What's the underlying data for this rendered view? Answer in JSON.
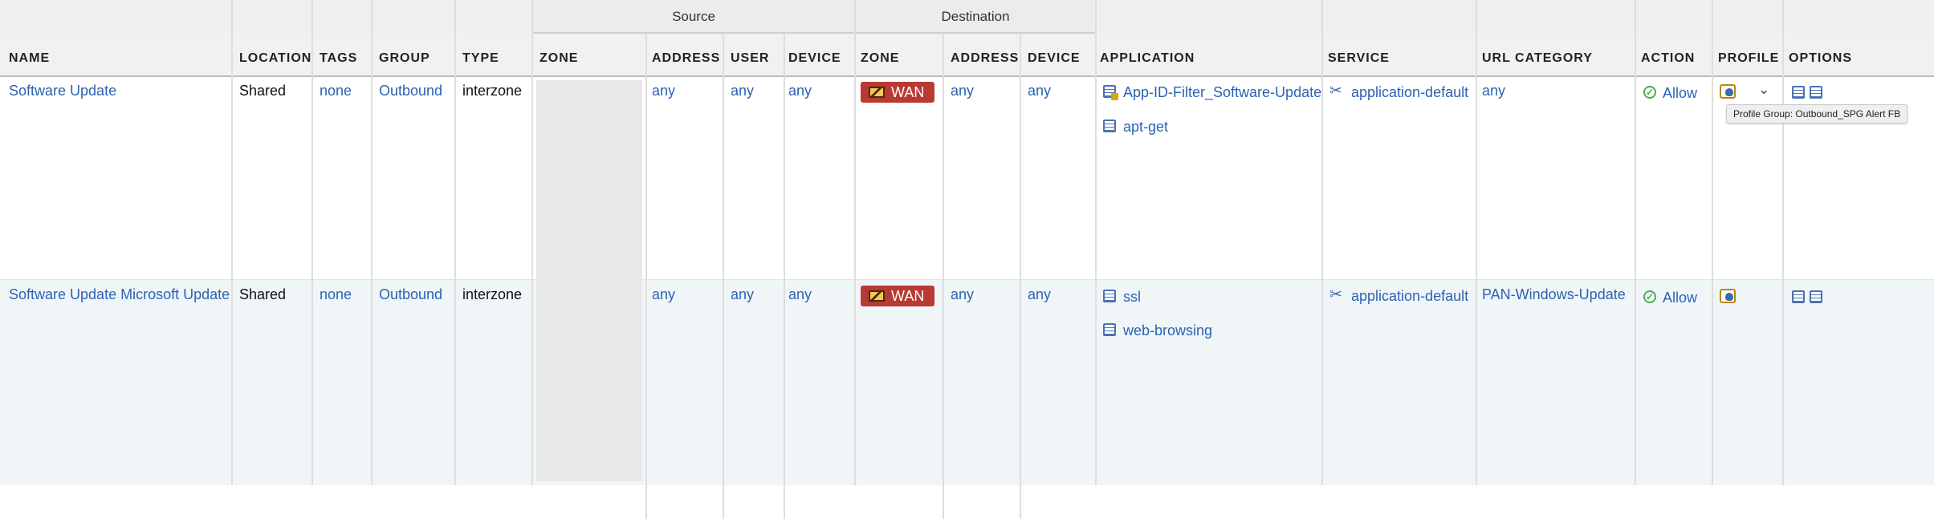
{
  "header": {
    "groups": {
      "source": "Source",
      "destination": "Destination"
    },
    "columns": {
      "name": "NAME",
      "location": "LOCATION",
      "tags": "TAGS",
      "group": "GROUP",
      "type": "TYPE",
      "src_zone": "ZONE",
      "src_address": "ADDRESS",
      "src_user": "USER",
      "src_device": "DEVICE",
      "dst_zone": "ZONE",
      "dst_address": "ADDRESS",
      "dst_device": "DEVICE",
      "application": "APPLICATION",
      "service": "SERVICE",
      "url_category": "URL CATEGORY",
      "action": "ACTION",
      "profile": "PROFILE",
      "options": "OPTIONS"
    }
  },
  "rows": [
    {
      "name": "Software Update",
      "location": "Shared",
      "tags": "none",
      "group": "Outbound",
      "type": "interzone",
      "src_address": "any",
      "src_user": "any",
      "src_device": "any",
      "dst_zone": "WAN",
      "dst_address": "any",
      "dst_device": "any",
      "applications": [
        "App-ID-Filter_Software-Update",
        "apt-get"
      ],
      "service": "application-default",
      "url_category": "any",
      "action": "Allow"
    },
    {
      "name": "Software Update Microsoft Update",
      "location": "Shared",
      "tags": "none",
      "group": "Outbound",
      "type": "interzone",
      "src_address": "any",
      "src_user": "any",
      "src_device": "any",
      "dst_zone": "WAN",
      "dst_address": "any",
      "dst_device": "any",
      "applications": [
        "ssl",
        "web-browsing"
      ],
      "service": "application-default",
      "url_category": "PAN-Windows-Update",
      "action": "Allow"
    }
  ],
  "tooltip": "Profile Group: Outbound_SPG Alert FB",
  "icons": {
    "zone": "zone-icon",
    "application": "application-icon",
    "application_filter": "application-filter-icon",
    "service": "service-tools-icon",
    "allow": "allow-check-icon",
    "profile": "security-profile-icon",
    "options": "log-options-icon",
    "chevron": "chevron-down-icon"
  },
  "colors": {
    "link": "#2b63b3",
    "wan_badge": "#b83a33",
    "allow": "#4cae4c",
    "row_alt": "#f0f5f8"
  }
}
